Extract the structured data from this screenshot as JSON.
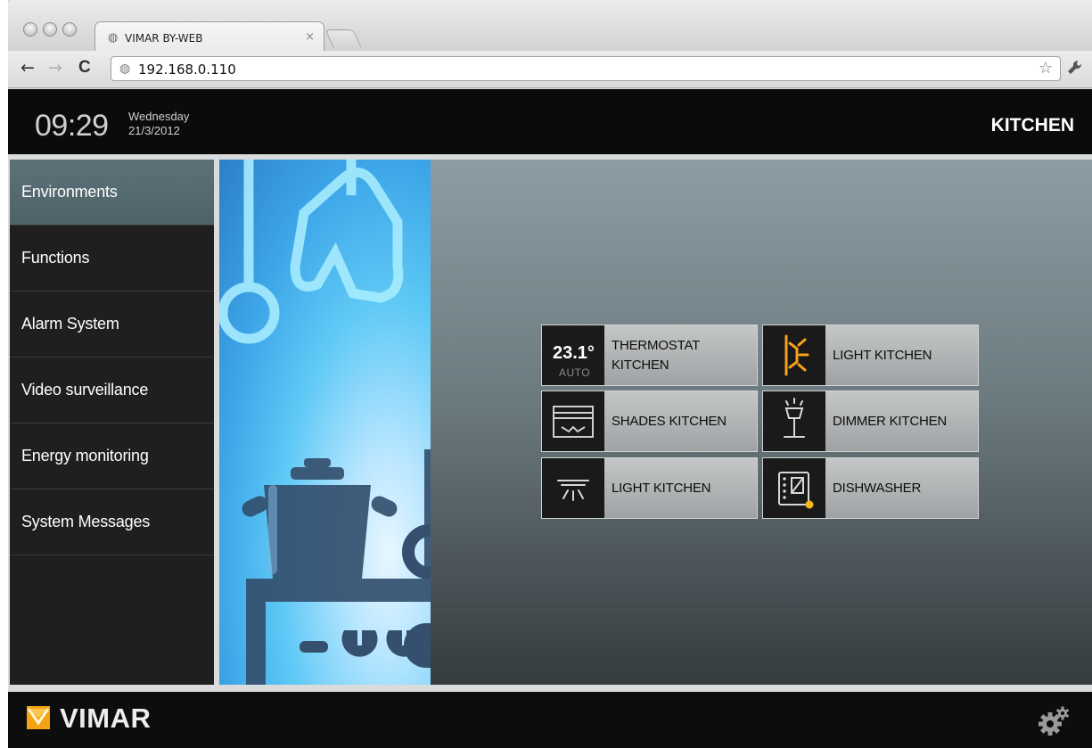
{
  "browser": {
    "tab_title": "VIMAR BY-WEB",
    "tab_close": "×",
    "url": "192.168.0.110",
    "back": "←",
    "forward": "→",
    "reload": "C",
    "star": "☆",
    "wrench": "🔧"
  },
  "header": {
    "time": "09:29",
    "day": "Wednesday",
    "date": "21/3/2012",
    "room": "KITCHEN"
  },
  "sidebar": {
    "items": [
      {
        "label": "Environments",
        "active": true
      },
      {
        "label": "Functions"
      },
      {
        "label": "Alarm System"
      },
      {
        "label": "Video surveillance"
      },
      {
        "label": "Energy monitoring"
      },
      {
        "label": "System Messages"
      }
    ]
  },
  "tiles": [
    {
      "label_line1": "THERMOSTAT",
      "label_line2": "KITCHEN",
      "temperature": "23.1°",
      "mode": "AUTO",
      "icon": "thermostat-readout"
    },
    {
      "label": "LIGHT KITCHEN",
      "icon": "light-on-icon",
      "state_color": "#f6a21a"
    },
    {
      "label": "SHADES KITCHEN",
      "icon": "shades-icon"
    },
    {
      "label": "DIMMER KITCHEN",
      "icon": "dimmer-lamp-icon"
    },
    {
      "label": "LIGHT KITCHEN",
      "icon": "ceiling-light-icon"
    },
    {
      "label": "DISHWASHER",
      "icon": "dishwasher-icon",
      "status_dot_color": "#f6b81a"
    }
  ],
  "footer": {
    "brand": "VIMAR",
    "logo_color": "#f2a414"
  },
  "colors": {
    "active_nav": "#586d73",
    "header_bg": "#0b0b0b",
    "accent_light": "#f6a21a"
  }
}
